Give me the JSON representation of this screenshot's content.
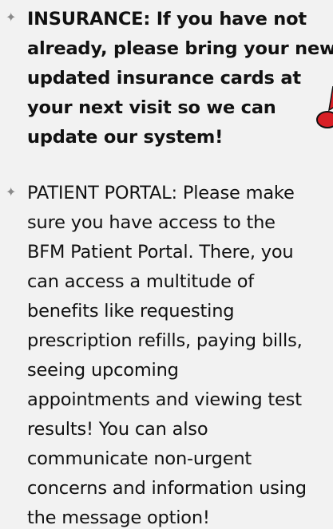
{
  "insurance": {
    "bullet_icon": "four-point-star-icon",
    "lines": [
      "INSURANCE: If you have not",
      "already, please bring your new",
      "updated insurance cards at",
      "your next visit so we can",
      "update our system!"
    ]
  },
  "portal": {
    "bullet_icon": "four-point-star-icon",
    "lead": "PATIENT PORTAL:",
    "first_line_rest": " Please make",
    "lines": [
      "sure you have access to the",
      "BFM Patient Portal. There, you",
      "can access a multitude of",
      "benefits like requesting",
      "prescription refills, paying bills,",
      "seeing upcoming",
      "appointments and viewing test",
      "results!  You can also",
      "communicate non-urgent",
      "concerns and information using",
      "the message option!"
    ]
  },
  "colors": {
    "background": "#f2f2f2",
    "text": "#111111",
    "bullet": "#8a8a8a",
    "accent_red": "#d81f26"
  }
}
